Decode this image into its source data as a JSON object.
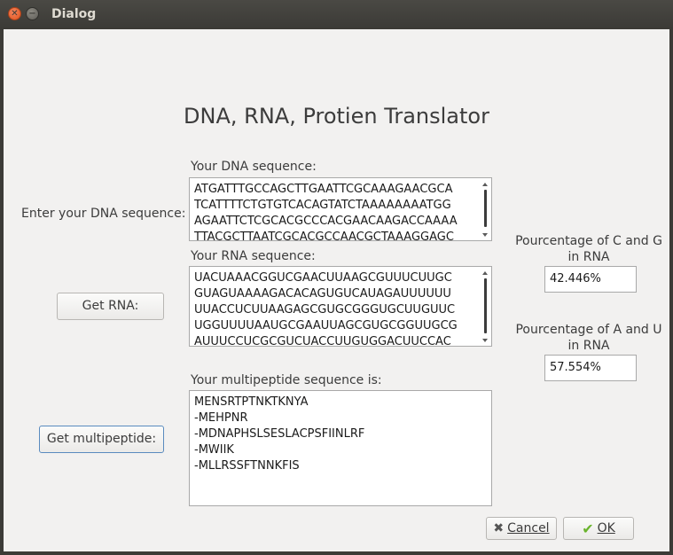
{
  "window": {
    "title": "Dialog"
  },
  "heading": "DNA, RNA, Protien Translator",
  "dna": {
    "prompt_label": "Enter your DNA sequence:",
    "box_label": "Your DNA sequence:",
    "lines": [
      "ATGATTTGCCAGCTTGAATTCGCAAAGAACGCA",
      "TCATTTTCTGTGTCACAGTATCTAAAAAAAATGG",
      "AGAATTCTCGCACGCCCACGAACAAGACCAAAA",
      "TTACGCTTAATCGCACGCCAACGCTAAAGGAGC"
    ]
  },
  "rna": {
    "button_label": "Get RNA:",
    "box_label": "Your RNA sequence:",
    "lines": [
      "UACUAAACGGUCGAACUUAAGCGUUUCUUGC",
      "GUAGUAAAAGACACAGUGUCAUAGAUUUUUU",
      "UUACCUCUUAAGAGCGUGCGGGUGCUUGUUC",
      "UGGUUUUAAUGCGAAUUAGCGUGCGGUUGCG",
      "AUUUCCUCGCGUCUACCUUGUGGACUUCCAC"
    ]
  },
  "peptide": {
    "button_label": "Get multipeptide:",
    "box_label": "Your multipeptide sequence is:",
    "lines": [
      "MENSRTPTNKTKNYA",
      "-MEHPNR",
      "-MDNAPHSLSESLACPSFIINLRF",
      "-MWIIK",
      "-MLLRSSFTNNKFIS"
    ]
  },
  "cg": {
    "label": "Pourcentage of C and G in RNA",
    "value": "42.446%"
  },
  "au": {
    "label": "Pourcentage of A and U in RNA",
    "value": "57.554%"
  },
  "buttons": {
    "cancel_label": "Cancel",
    "ok_label": "OK"
  },
  "scroll": {
    "dna_position": 0.0,
    "rna_position": 0.0
  }
}
